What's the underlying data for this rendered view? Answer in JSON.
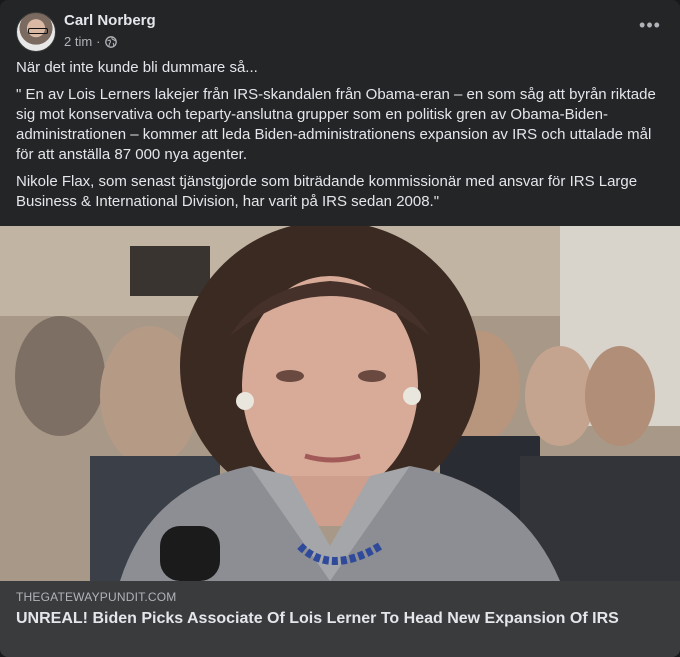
{
  "post": {
    "author": "Carl Norberg",
    "time": "2 tim",
    "separator": "·",
    "privacy_icon": "globe-icon",
    "more_label": "•••",
    "paragraphs": [
      "När det inte kunde bli dummare så...",
      "\" En av Lois Lerners lakejer från IRS-skandalen från Obama-eran – en som såg att byrån riktade sig mot konservativa och teparty-anslutna grupper som en politisk gren av Obama-Biden-administrationen – kommer att leda Biden-administrationens expansion av IRS och uttalade mål för att anställa 87 000 nya agenter.",
      "Nikole Flax, som senast tjänstgjorde som biträdande kommissionär med ansvar för IRS Large Business & International Division, har varit på IRS sedan 2008.\""
    ]
  },
  "link_preview": {
    "domain": "THEGATEWAYPUNDIT.COM",
    "title": "UNREAL! Biden Picks Associate Of Lois Lerner To Head New Expansion Of IRS"
  },
  "colors": {
    "background": "#18191a",
    "card": "#242526",
    "preview_bg": "#3a3b3c",
    "primary_text": "#e4e6eb",
    "secondary_text": "#b0b3b8"
  }
}
